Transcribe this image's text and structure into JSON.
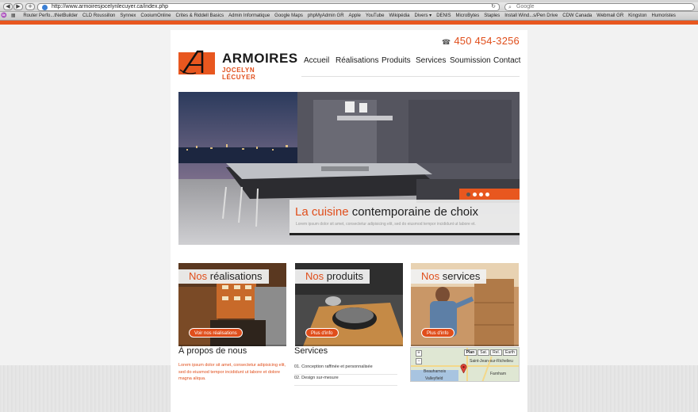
{
  "browser": {
    "url": "http://www.armoiresjocelynlecuyer.ca/index.php",
    "search_placeholder": "Google",
    "bookmarks": [
      "Router Perfo...tNetBuilder",
      "CLD Roussillon",
      "Synnex",
      "CooiumOnline",
      "Crites & Riddell Basics",
      "Admin Informatique",
      "Google Maps",
      "phpMyAdmin GR",
      "Apple",
      "YouTube",
      "Wikipédia",
      "Divers ▾",
      "DENIS",
      "MicroBytes",
      "Staples",
      "Install Wind...s/Pen Drive",
      "CDW Canada",
      "Webmail GR",
      "Kingston",
      "Humoristes"
    ]
  },
  "header": {
    "phone": "450 454-3256",
    "logo_line1": "ARMOIRES",
    "logo_line2": "JOCELYN LÉCUYER",
    "menu": [
      "Accueil",
      "Réalisations",
      "Produits",
      "Services",
      "Soumission",
      "Contact"
    ]
  },
  "hero": {
    "title_accent": "La cuisine",
    "title_rest": " contemporaine de choix",
    "subtitle": "Lorem ipsum dolor sit amet, consectetur adipisicing elit, sed do eiusmod tempor incididunt ut labore et.",
    "slide_count": 4,
    "active_slide": 1
  },
  "boxes": [
    {
      "accent": "Nos",
      "rest": " réalisations",
      "button": "Voir nos réalisations"
    },
    {
      "accent": "Nos",
      "rest": " produits",
      "button": "Plus d'info"
    },
    {
      "accent": "Nos",
      "rest": " services",
      "button": "Plus d'info"
    }
  ],
  "about": {
    "title": "À propos de nous",
    "text": "Lorem ipsum dolor sit amet, consectetur adipisicing elit, sed do eiusmod tempor incididunt ut labore et dolore magna aliqua."
  },
  "services": {
    "title": "Services",
    "items": [
      "01.  Conception raffinée et personnalisée",
      "02.  Design sur-mesure"
    ]
  },
  "map": {
    "buttons": [
      "Plan",
      "Sat.",
      "Rel.",
      "Earth"
    ],
    "selected": "Plan",
    "places": [
      "Saint-Jean-sur-Richelieu",
      "Beauharnois",
      "Farnham",
      "Valleyfield"
    ]
  },
  "colors": {
    "accent": "#e04e1b",
    "orange_bar": "#e8571f"
  }
}
